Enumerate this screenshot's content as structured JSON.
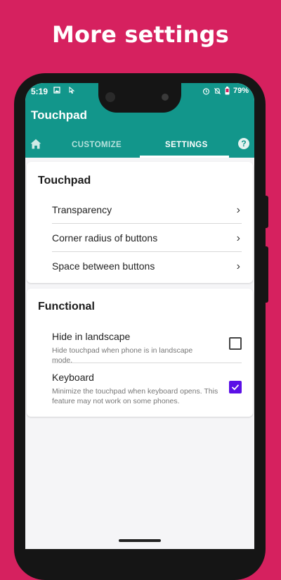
{
  "promo": {
    "title": "More settings"
  },
  "status": {
    "time": "5:19",
    "battery": "79%"
  },
  "appbar": {
    "title": "Touchpad"
  },
  "tabs": [
    {
      "label": "CUSTOMIZE",
      "selected": false
    },
    {
      "label": "SETTINGS",
      "selected": true
    }
  ],
  "sections": {
    "touchpad": {
      "title": "Touchpad",
      "items": [
        {
          "label": "Transparency"
        },
        {
          "label": "Corner radius of buttons"
        },
        {
          "label": "Space between buttons"
        }
      ]
    },
    "functional": {
      "title": "Functional",
      "items": [
        {
          "label": "Hide in landscape",
          "description": "Hide touchpad when phone is in landscape mode.",
          "checked": false
        },
        {
          "label": "Keyboard",
          "description": "Minimize the touchpad when keyboard opens. This feature may not work on some phones.",
          "checked": true
        }
      ]
    }
  },
  "colors": {
    "background": "#d6215f",
    "primary": "#12968b",
    "accent": "#5b10e6"
  },
  "icons": [
    "home-icon",
    "help-icon",
    "chevron-right-icon",
    "checkbox-icon"
  ]
}
